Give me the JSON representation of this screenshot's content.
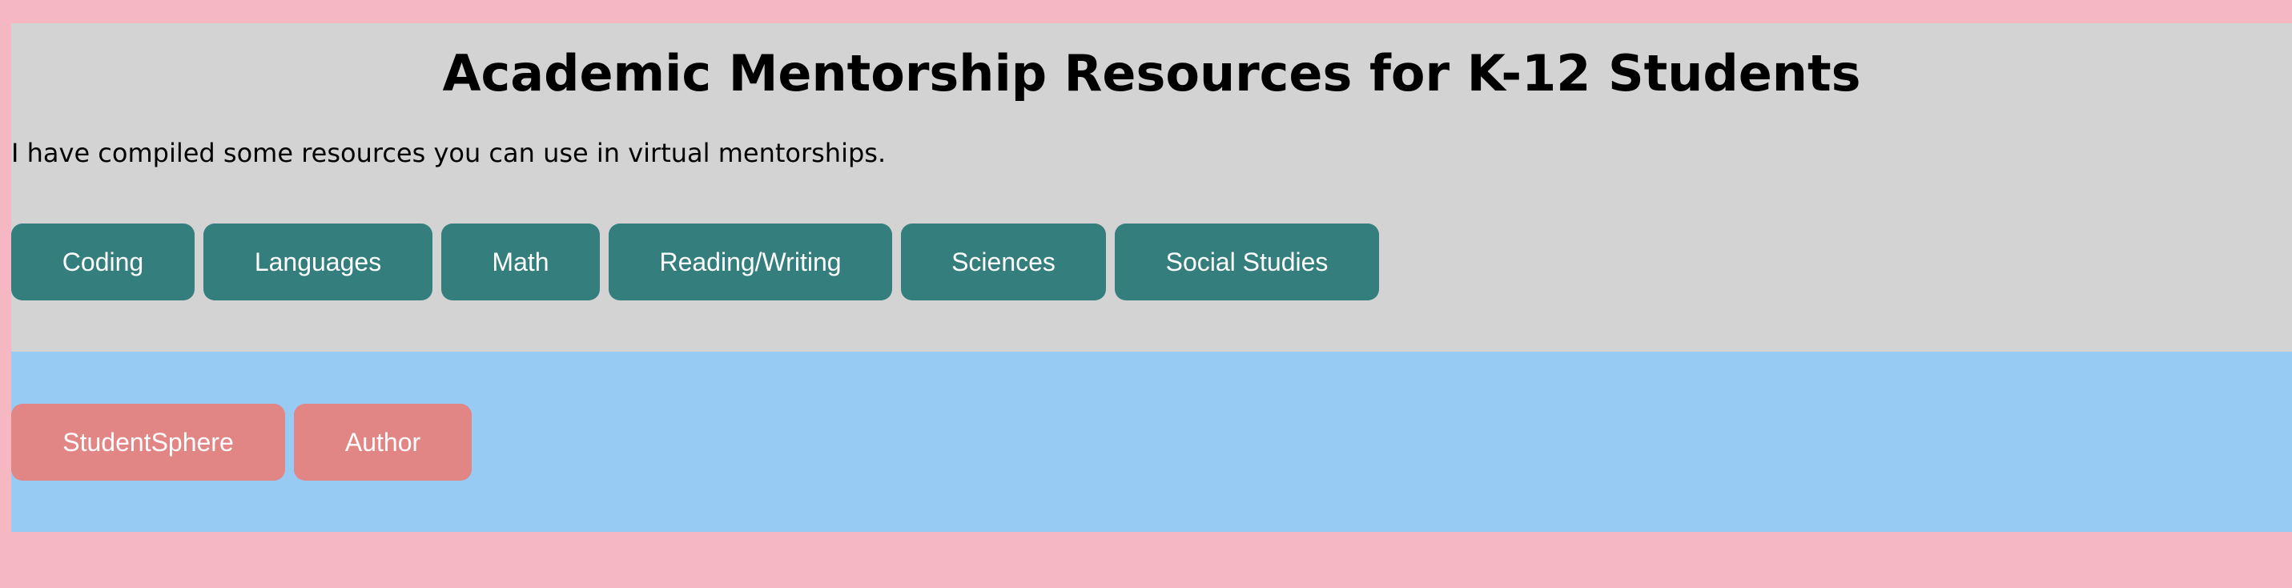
{
  "header": {
    "title": "Academic Mentorship Resources for K-12 Students",
    "intro": "I have compiled some resources you can use in virtual mentorships."
  },
  "subjects": [
    {
      "label": "Coding"
    },
    {
      "label": "Languages"
    },
    {
      "label": "Math"
    },
    {
      "label": "Reading/Writing"
    },
    {
      "label": "Sciences"
    },
    {
      "label": "Social Studies"
    }
  ],
  "footer_links": [
    {
      "label": "StudentSphere"
    },
    {
      "label": "Author"
    }
  ],
  "colors": {
    "page_background": "#f5b8c2",
    "header_background": "#d3d3d3",
    "footer_background": "#97cbf4",
    "subject_button": "#347e7e",
    "footer_button": "#e28585"
  }
}
